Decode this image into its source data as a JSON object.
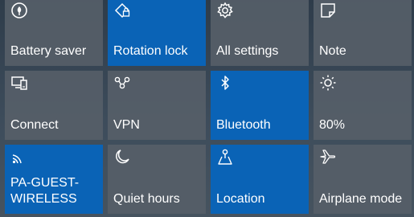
{
  "action_center": {
    "accent_color": "#0a63b6",
    "tile_color": "#565e68",
    "tiles": [
      {
        "label": "Battery saver",
        "icon": "battery-saver-icon",
        "active": false
      },
      {
        "label": "Rotation lock",
        "icon": "rotation-lock-icon",
        "active": true
      },
      {
        "label": "All settings",
        "icon": "gear-icon",
        "active": false
      },
      {
        "label": "Note",
        "icon": "note-icon",
        "active": false
      },
      {
        "label": "Connect",
        "icon": "connect-icon",
        "active": false
      },
      {
        "label": "VPN",
        "icon": "vpn-icon",
        "active": false
      },
      {
        "label": "Bluetooth",
        "icon": "bluetooth-icon",
        "active": true
      },
      {
        "label": "80%",
        "icon": "brightness-icon",
        "active": false
      },
      {
        "label": "PA-GUEST-\nWIRELESS",
        "icon": "wifi-icon",
        "active": true
      },
      {
        "label": "Quiet hours",
        "icon": "moon-icon",
        "active": false
      },
      {
        "label": "Location",
        "icon": "location-icon",
        "active": true
      },
      {
        "label": "Airplane mode",
        "icon": "airplane-icon",
        "active": false
      }
    ]
  }
}
